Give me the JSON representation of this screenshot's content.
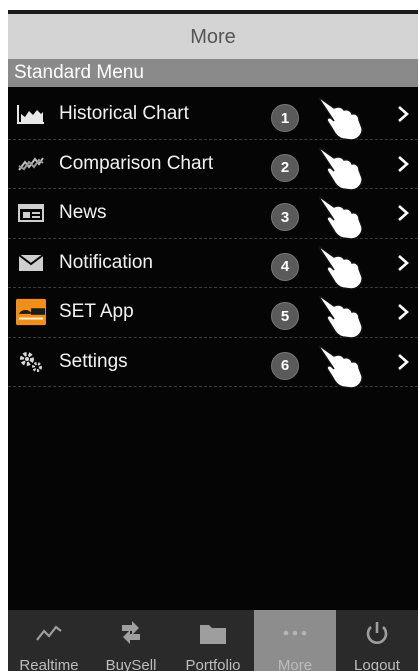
{
  "header": {
    "title": "More"
  },
  "section": {
    "title": "Standard Menu"
  },
  "menu": {
    "items": [
      {
        "label": "Historical Chart",
        "icon": "area-chart-icon",
        "step": "1"
      },
      {
        "label": "Comparison Chart",
        "icon": "comparison-chart-icon",
        "step": "2"
      },
      {
        "label": "News",
        "icon": "news-icon",
        "step": "3"
      },
      {
        "label": "Notification",
        "icon": "envelope-icon",
        "step": "4"
      },
      {
        "label": "SET App",
        "icon": "set-app-logo",
        "step": "5"
      },
      {
        "label": "Settings",
        "icon": "gears-icon",
        "step": "6"
      }
    ]
  },
  "tabs": [
    {
      "label": "Realtime",
      "icon": "line-chart-icon"
    },
    {
      "label": "BuySell",
      "icon": "swap-arrows-icon"
    },
    {
      "label": "Portfolio",
      "icon": "folder-icon"
    },
    {
      "label": "More",
      "icon": "dots-icon",
      "active": true
    },
    {
      "label": "Logout",
      "icon": "power-icon"
    }
  ],
  "colors": {
    "header_bg": "#d4d4d4",
    "section_bg": "#8a8a8a",
    "screen_bg": "#050505",
    "active_tab": "#8d8d8d"
  }
}
